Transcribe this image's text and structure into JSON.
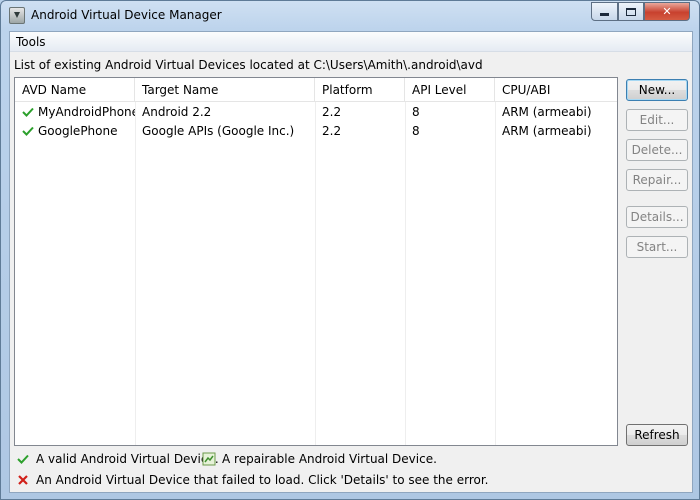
{
  "window": {
    "title": "Android Virtual Device Manager"
  },
  "menu": {
    "tools": "Tools"
  },
  "list_label": "List of existing Android Virtual Devices located at C:\\Users\\Amith\\.android\\avd",
  "table": {
    "columns": [
      "AVD Name",
      "Target Name",
      "Platform",
      "API Level",
      "CPU/ABI"
    ],
    "rows": [
      {
        "status_icon": "valid-check-icon",
        "name": "MyAndroidPhone",
        "target": "Android 2.2",
        "platform": "2.2",
        "api": "8",
        "cpu": "ARM (armeabi)"
      },
      {
        "status_icon": "valid-check-icon",
        "name": "GooglePhone",
        "target": "Google APIs (Google Inc.)",
        "platform": "2.2",
        "api": "8",
        "cpu": "ARM (armeabi)"
      }
    ]
  },
  "buttons": {
    "new": "New...",
    "edit": "Edit...",
    "delete": "Delete...",
    "repair": "Repair...",
    "details": "Details...",
    "start": "Start...",
    "refresh": "Refresh"
  },
  "legend": {
    "valid": "A valid Android Virtual Device.",
    "repairable": "A repairable Android Virtual Device.",
    "failed": "An Android Virtual Device that failed to load. Click 'Details' to see the error."
  },
  "colors": {
    "valid_check": "#2ca02c",
    "error_x": "#d0201a"
  }
}
